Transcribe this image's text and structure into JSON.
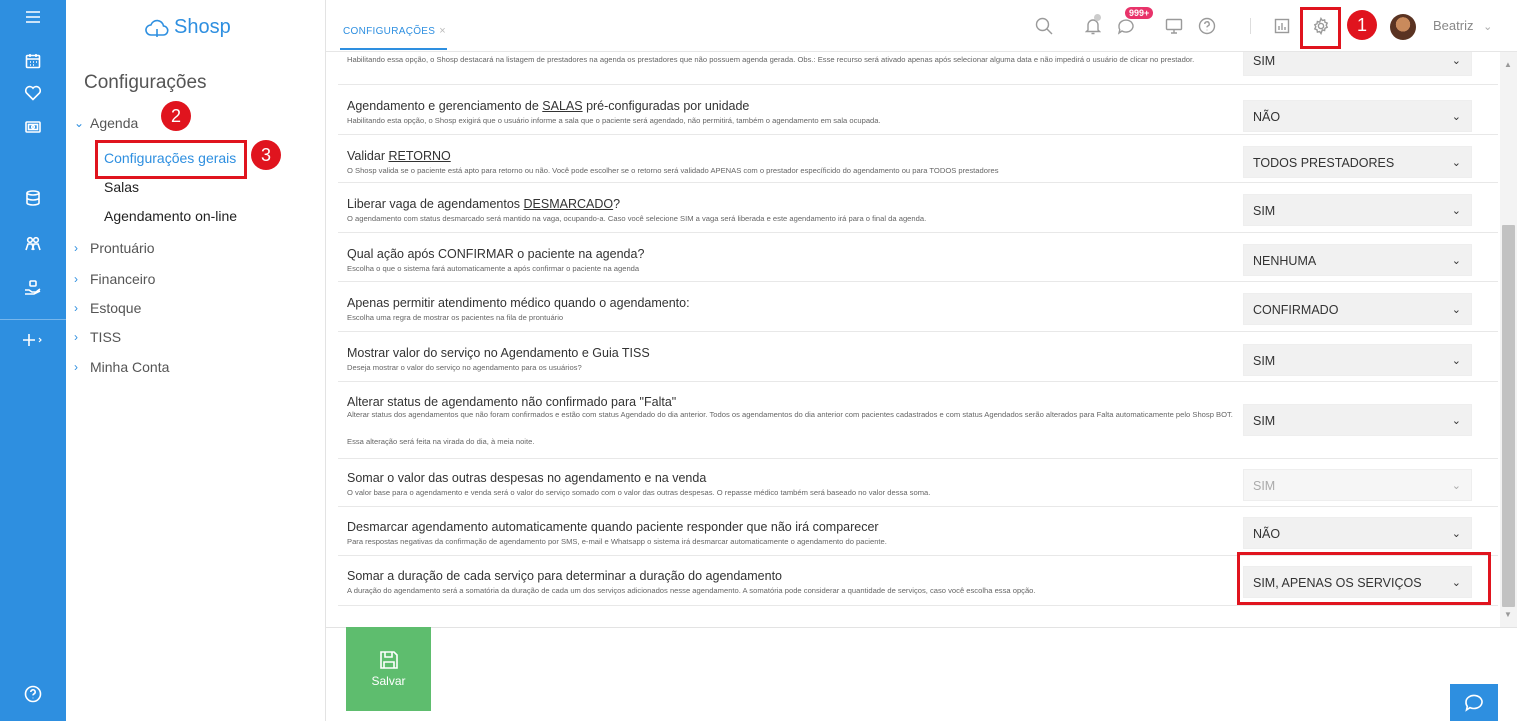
{
  "app": {
    "logo_text": "Shosp",
    "page_title": "Configurações"
  },
  "tab": {
    "label": "CONFIGURAÇÕES",
    "close": "×"
  },
  "topbar": {
    "notifications_badge": "999+",
    "user_name": "Beatriz",
    "user_caret": "⌄"
  },
  "sidebar": {
    "sections": [
      {
        "label": "Agenda",
        "expanded": true
      },
      {
        "label": "Prontuário"
      },
      {
        "label": "Financeiro"
      },
      {
        "label": "Estoque"
      },
      {
        "label": "TISS"
      },
      {
        "label": "Minha Conta"
      }
    ],
    "agenda_items": [
      {
        "label": "Configurações gerais",
        "active": true
      },
      {
        "label": "Salas"
      },
      {
        "label": "Agendamento on-line"
      }
    ]
  },
  "settings": [
    {
      "title": "",
      "desc": "Habilitando essa opção, o Shosp destacará na listagem de prestadores na agenda os prestadores que não possuem agenda gerada. Obs.: Esse recurso será ativado apenas após selecionar alguma data e não impedirá o usuário de clicar no prestador.",
      "value": "SIM"
    },
    {
      "title_pre": "Agendamento e gerenciamento de ",
      "title_u": "SALAS",
      "title_post": " pré-configuradas por unidade",
      "desc": "Habilitando esta opção, o Shosp exigirá que o usuário informe a sala que o paciente será agendado, não permitirá, também o agendamento em sala ocupada.",
      "value": "NÃO"
    },
    {
      "title_pre": "Validar ",
      "title_u": "RETORNO",
      "title_post": "",
      "desc": "O Shosp valida se o paciente está apto para retorno ou não. Você pode escolher se o retorno será validado APENAS com o prestador específicido do agendamento ou para TODOS prestadores",
      "value": "TODOS PRESTADORES"
    },
    {
      "title_pre": "Liberar vaga de agendamentos ",
      "title_u": "DESMARCADO",
      "title_post": "?",
      "desc": "O agendamento com status desmarcado será mantido na vaga, ocupando-a. Caso você selecione SIM a vaga será liberada e este agendamento irá para o final da agenda.",
      "value": "SIM"
    },
    {
      "title": "Qual ação após CONFIRMAR o paciente na agenda?",
      "desc": "Escolha o que o sistema fará automaticamente a após confirmar o paciente na agenda",
      "value": "NENHUMA"
    },
    {
      "title": "Apenas permitir atendimento médico quando o agendamento:",
      "desc": "Escolha uma regra de mostrar os pacientes na fila de prontuário",
      "value": "CONFIRMADO"
    },
    {
      "title": "Mostrar valor do serviço no Agendamento e Guia TISS",
      "desc": "Deseja mostrar o valor do serviço no agendamento para os usuários?",
      "value": "SIM"
    },
    {
      "title": "Alterar status de agendamento não confirmado para \"Falta\"",
      "desc": "Alterar status dos agendamentos que não foram confirmados e estão com status Agendado do dia anterior. Todos os agendamentos do dia anterior com pacientes cadastrados e com status Agendados serão alterados para Falta automaticamente pelo Shosp BOT.",
      "desc2": "Essa alteração será feita na virada do dia, à meia noite.",
      "value": "SIM"
    },
    {
      "title": "Somar o valor das outras despesas no agendamento e na venda",
      "desc": "O valor base para o agendamento e venda será o valor do serviço somado com o valor das outras despesas. O repasse médico também será baseado no valor dessa soma.",
      "value": "SIM",
      "disabled": true
    },
    {
      "title": "Desmarcar agendamento automaticamente quando paciente responder que não irá comparecer",
      "desc": "Para respostas negativas da confirmação de agendamento por SMS, e-mail e Whatsapp o sistema irá desmarcar automaticamente o agendamento do paciente.",
      "value": "NÃO"
    },
    {
      "title": "Somar a duração de cada serviço para determinar a duração do agendamento",
      "desc": "A duração do agendamento será a somatória da duração de cada um dos serviços adicionados nesse agendamento. A somatória pode considerar a quantidade de serviços, caso você escolha essa opção.",
      "value": "SIM, APENAS OS SERVIÇOS"
    }
  ],
  "save_label": "Salvar",
  "annotations": [
    "1",
    "2",
    "3"
  ],
  "colors": {
    "accent": "#2e8fe0",
    "save": "#5ebd6e",
    "highlight": "#e0141e",
    "badge": "#e8336a"
  }
}
